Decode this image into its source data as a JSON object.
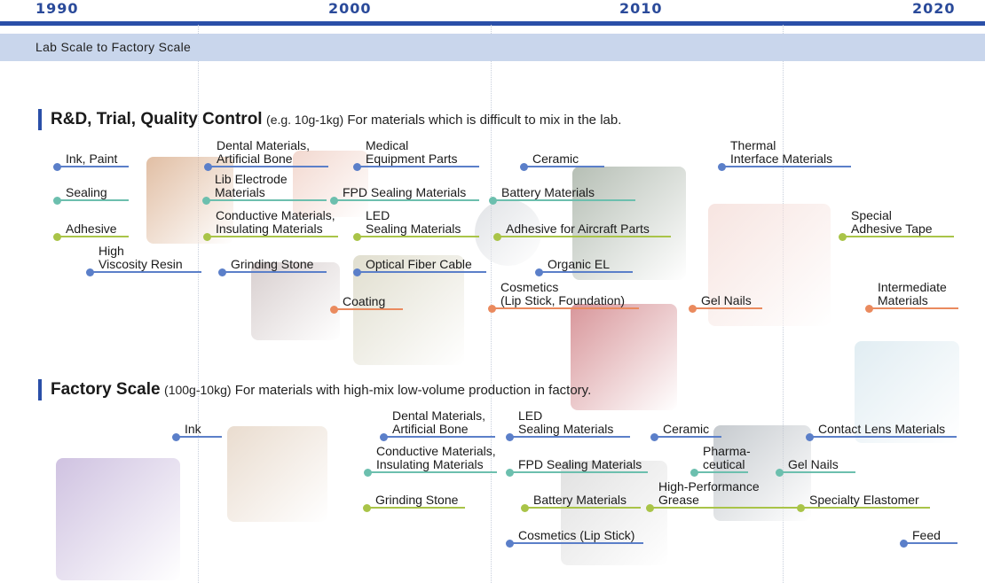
{
  "timeline": {
    "years": [
      "1990",
      "2000",
      "2010",
      "2020"
    ],
    "band_label": "Lab Scale to Factory Scale"
  },
  "rnd": {
    "title": "R&D, Trial, Quality Control",
    "scale": "(e.g. 10g-1kg)",
    "desc": "For materials which is difficult to mix in the lab."
  },
  "factory": {
    "title": "Factory Scale",
    "scale": "(100g-10kg)",
    "desc": "For materials with high-mix low-volume production in factory."
  },
  "rnd_items": [
    {
      "label": "Ink, Paint",
      "color": "blue"
    },
    {
      "label": "Sealing",
      "color": "teal"
    },
    {
      "label": "Adhesive",
      "color": "green"
    },
    {
      "label": "High\nViscosity Resin",
      "color": "blue"
    },
    {
      "label": "Dental Materials,\nArtificial Bone",
      "color": "blue"
    },
    {
      "label": "Lib Electrode\nMaterials",
      "color": "teal"
    },
    {
      "label": "Conductive Materials,\nInsulating Materials",
      "color": "green"
    },
    {
      "label": "Grinding Stone",
      "color": "blue"
    },
    {
      "label": "Medical\nEquipment Parts",
      "color": "blue"
    },
    {
      "label": "FPD Sealing Materials",
      "color": "teal"
    },
    {
      "label": "LED\nSealing Materials",
      "color": "green"
    },
    {
      "label": "Optical Fiber Cable",
      "color": "blue"
    },
    {
      "label": "Coating",
      "color": "orange"
    },
    {
      "label": "Ceramic",
      "color": "blue"
    },
    {
      "label": "Battery Materials",
      "color": "teal"
    },
    {
      "label": "Adhesive for Aircraft Parts",
      "color": "green"
    },
    {
      "label": "Organic EL",
      "color": "blue"
    },
    {
      "label": "Cosmetics\n(Lip Stick, Foundation)",
      "color": "orange"
    },
    {
      "label": "Thermal\nInterface Materials",
      "color": "blue"
    },
    {
      "label": "Gel Nails",
      "color": "orange"
    },
    {
      "label": "Special\nAdhesive Tape",
      "color": "green"
    },
    {
      "label": "Intermediate\nMaterials",
      "color": "orange"
    }
  ],
  "factory_items": [
    {
      "label": "Ink",
      "color": "blue"
    },
    {
      "label": "Dental Materials,\nArtificial Bone",
      "color": "blue"
    },
    {
      "label": "Conductive Materials,\nInsulating Materials",
      "color": "teal"
    },
    {
      "label": "Grinding Stone",
      "color": "green"
    },
    {
      "label": "LED\nSealing Materials",
      "color": "blue"
    },
    {
      "label": "FPD Sealing Materials",
      "color": "teal"
    },
    {
      "label": "Battery Materials",
      "color": "green"
    },
    {
      "label": "Cosmetics (Lip Stick)",
      "color": "blue"
    },
    {
      "label": "Ceramic",
      "color": "blue"
    },
    {
      "label": "Pharma-\nceutical",
      "color": "teal"
    },
    {
      "label": "High-Performance\nGrease",
      "color": "green"
    },
    {
      "label": "Contact Lens Materials",
      "color": "blue"
    },
    {
      "label": "Gel Nails",
      "color": "teal"
    },
    {
      "label": "Specialty Elastomer",
      "color": "green"
    },
    {
      "label": "Feed",
      "color": "blue"
    }
  ],
  "images": [
    {
      "name": "copper-wire-photo",
      "color": "#c98a5a"
    },
    {
      "name": "dental-model-photo",
      "color": "#e8b8a8"
    },
    {
      "name": "coin-battery-photo",
      "color": "#c8ccd2"
    },
    {
      "name": "circuit-board-photo",
      "color": "#7a8a78"
    },
    {
      "name": "grinding-wheel-photo",
      "color": "#b8a8a8"
    },
    {
      "name": "led-light-photo",
      "color": "#c8c4a8"
    },
    {
      "name": "gel-nails-photo",
      "color": "#f0cfc8"
    },
    {
      "name": "lipstick-photo",
      "color": "#b84048"
    },
    {
      "name": "contact-lens-photo",
      "color": "#c8dee8"
    },
    {
      "name": "pigment-powder-photo",
      "color": "#a890c8"
    },
    {
      "name": "paint-cans-photo",
      "color": "#d8c0a8"
    },
    {
      "name": "lipstick-tube-photo",
      "color": "#c8c8c8"
    },
    {
      "name": "microchip-photo",
      "color": "#98a0a8"
    }
  ]
}
